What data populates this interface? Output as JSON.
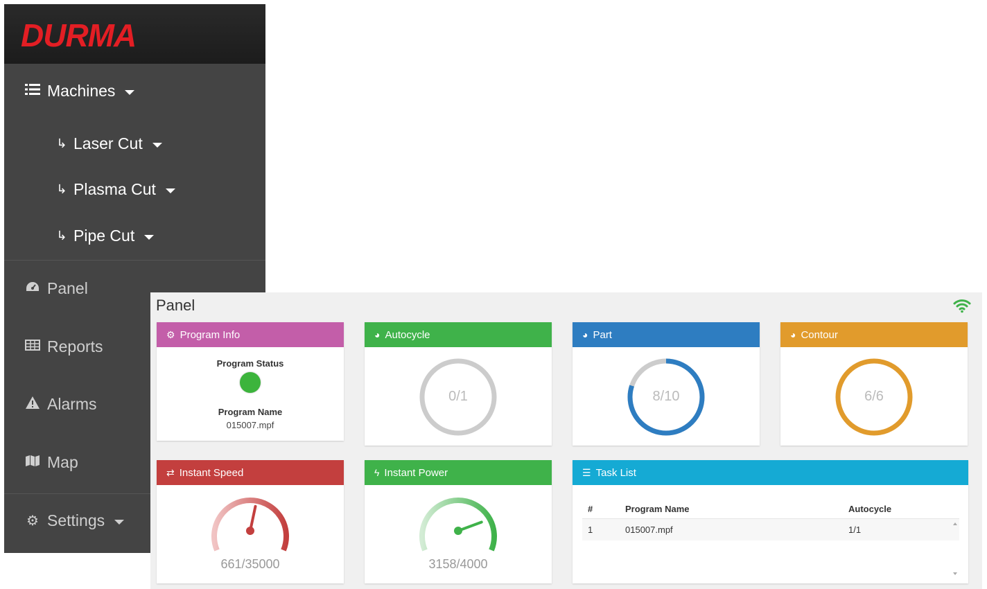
{
  "sidebar": {
    "brand": "DURMA",
    "machines": {
      "label": "Machines",
      "icon": "list-icon"
    },
    "sub_items": [
      {
        "label": "Laser Cut",
        "icon": "arrow-return-icon"
      },
      {
        "label": "Plasma Cut",
        "icon": "arrow-return-icon"
      },
      {
        "label": "Pipe Cut",
        "icon": "arrow-return-icon"
      }
    ],
    "items": [
      {
        "label": "Panel",
        "icon": "dashboard-icon"
      },
      {
        "label": "Reports",
        "icon": "table-icon"
      },
      {
        "label": "Alarms",
        "icon": "warning-icon"
      },
      {
        "label": "Map",
        "icon": "map-icon"
      },
      {
        "label": "Settings",
        "icon": "gear-icon"
      }
    ]
  },
  "panel": {
    "title": "Panel",
    "wifi_icon": "wifi-icon",
    "cards": {
      "program_info": {
        "title": "Program Info",
        "color": "#c35ea9",
        "status_label": "Program Status",
        "status_color": "#3cb43c",
        "name_label": "Program Name",
        "name_value": "015007.mpf"
      },
      "autocycle": {
        "title": "Autocycle",
        "color": "#3fb24a",
        "value": "0/1",
        "fraction": 0,
        "ring_color": "#cccccc"
      },
      "part": {
        "title": "Part",
        "color": "#2e7dc1",
        "value": "8/10",
        "fraction": 0.8,
        "ring_color": "#2e7dc1"
      },
      "contour": {
        "title": "Contour",
        "color": "#e19b2c",
        "value": "6/6",
        "fraction": 1,
        "ring_color": "#e19b2c"
      },
      "instant_speed": {
        "title": "Instant Speed",
        "color": "#c33f3e",
        "value": "661/35000",
        "fraction": 0.019
      },
      "instant_power": {
        "title": "Instant Power",
        "color": "#3fb24a",
        "value": "3158/4000",
        "fraction": 0.79
      },
      "task_list": {
        "title": "Task List",
        "color": "#15aad4",
        "columns": [
          "#",
          "Program Name",
          "Autocycle"
        ],
        "rows": [
          {
            "num": "1",
            "name": "015007.mpf",
            "autocycle": "1/1"
          }
        ]
      }
    }
  }
}
